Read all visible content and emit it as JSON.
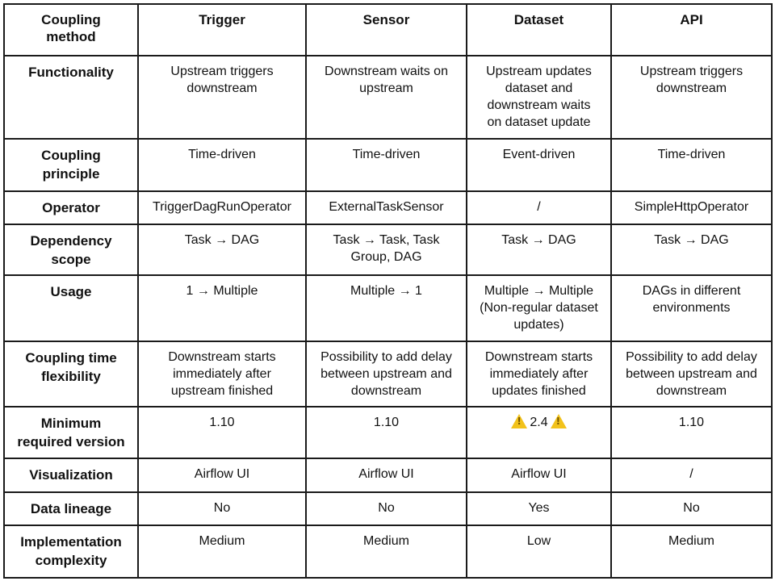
{
  "table": {
    "header": {
      "corner": "Coupling\nmethod",
      "columns": [
        "Trigger",
        "Sensor",
        "Dataset",
        "API"
      ]
    },
    "rows": [
      {
        "label": "Functionality",
        "cells": [
          "Upstream triggers\ndownstream",
          "Downstream waits on\nupstream",
          "Upstream updates\ndataset and\ndownstream waits\non dataset update",
          "Upstream triggers\ndownstream"
        ]
      },
      {
        "label": "Coupling\nprinciple",
        "cells": [
          "Time-driven",
          "Time-driven",
          "Event-driven",
          "Time-driven"
        ]
      },
      {
        "label": "Operator",
        "cells": [
          "TriggerDagRunOperator",
          "ExternalTaskSensor",
          "/",
          "SimpleHttpOperator"
        ]
      },
      {
        "label": "Dependency\nscope",
        "cells": [
          "Task → DAG",
          "Task → Task, Task\nGroup, DAG",
          "Task → DAG",
          "Task → DAG"
        ]
      },
      {
        "label": "Usage",
        "cells": [
          "1 → Multiple",
          "Multiple → 1",
          "Multiple → Multiple\n(Non-regular dataset\nupdates)",
          "DAGs in different\nenvironments"
        ]
      },
      {
        "label": "Coupling time\nflexibility",
        "cells": [
          "Downstream starts\nimmediately after\nupstream finished",
          "Possibility to add delay\nbetween upstream and\ndownstream",
          "Downstream starts\nimmediately after\nupdates finished",
          "Possibility to add delay\nbetween upstream and\ndownstream"
        ]
      },
      {
        "label": "Minimum\nrequired version",
        "cells": [
          "1.10",
          "1.10",
          "2.4",
          "1.10"
        ]
      },
      {
        "label": "Visualization",
        "cells": [
          "Airflow UI",
          "Airflow UI",
          "Airflow UI",
          "/"
        ]
      },
      {
        "label": "Data lineage",
        "cells": [
          "No",
          "No",
          "Yes",
          "No"
        ]
      },
      {
        "label": "Implementation\ncomplexity",
        "cells": [
          "Medium",
          "Medium",
          "Low",
          "Medium"
        ]
      }
    ],
    "warning_icon_color": "#f2c21b"
  }
}
